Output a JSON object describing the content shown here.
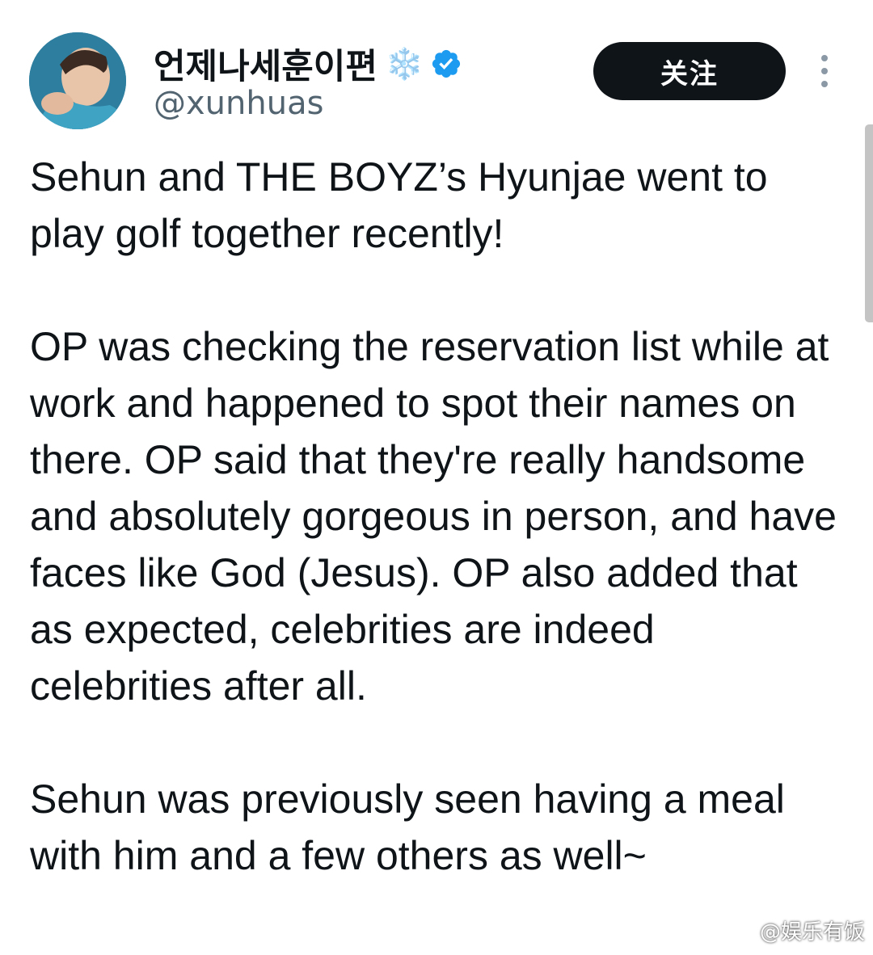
{
  "user": {
    "display_name": "언제나세훈이편",
    "emoji": "❄️",
    "verified_icon": "verified-badge-icon",
    "handle": "@xunhuas"
  },
  "actions": {
    "follow_label": "关注",
    "more_icon": "more-vertical-icon"
  },
  "tweet": {
    "paragraphs": [
      "Sehun and THE BOYZ’s Hyunjae went to play golf together recently!",
      "OP was checking the reservation list while at work and happened to spot their names on there. OP said that they're really handsome and absolutely gorgeous in person, and have faces like God (Jesus). OP also added that as expected, celebrities are indeed celebrities after all.",
      "Sehun was previously seen having a meal with him and a few others as well~"
    ]
  },
  "watermark": {
    "text": "@娱乐有饭",
    "icon": "weibo-icon"
  },
  "colors": {
    "text": "#0f1419",
    "handle": "#536471",
    "verified": "#1d9bf0",
    "button_bg": "#0f1419"
  }
}
